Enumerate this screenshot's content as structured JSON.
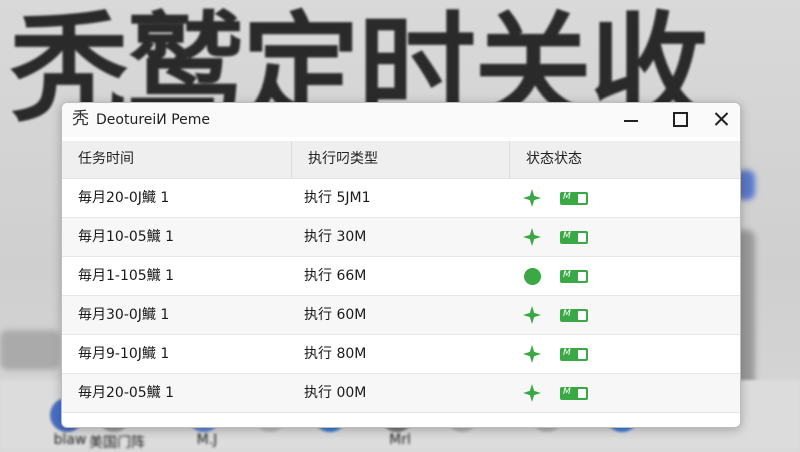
{
  "background": {
    "title_text": "秃鹫定时关收",
    "taskbar": [
      {
        "label": "blaw",
        "icon": "app-icon",
        "color": "#4a6fc4"
      },
      {
        "label": "美国门阵",
        "icon": "app-icon",
        "color": "#9a9a9a"
      },
      {
        "label": "M.J",
        "icon": "app-icon",
        "color": "#5d86d9"
      },
      {
        "label": "",
        "icon": "app-icon",
        "color": "#bdbdbd"
      },
      {
        "label": "",
        "icon": "app-icon",
        "color": "#3a7fd8"
      },
      {
        "label": "Mrl",
        "icon": "app-icon",
        "color": "#7a7a7a"
      },
      {
        "label": "",
        "icon": "app-icon",
        "color": "#b5b5b5"
      },
      {
        "label": "",
        "icon": "app-icon",
        "color": "#b5b5b5"
      },
      {
        "label": "",
        "icon": "app-icon",
        "color": "#3f7fd6"
      }
    ]
  },
  "window": {
    "icon_glyph": "秃",
    "title": "DeotureiИ Peme",
    "controls": {
      "minimize": "minimize",
      "maximize": "maximize",
      "close": "close"
    }
  },
  "table": {
    "columns": [
      "任务时间",
      "执行叼类型",
      "状态状态"
    ],
    "rows": [
      {
        "time": "毎月20-0J鱵 1",
        "type": "执行 5JM1",
        "status_icon": "star",
        "toggle": "M"
      },
      {
        "time": "毎月10-05鱵 1",
        "type": "执行 30M",
        "status_icon": "star",
        "toggle": "M"
      },
      {
        "time": "毎月1-105鱵 1",
        "type": "执行 66M",
        "status_icon": "dot",
        "toggle": "M"
      },
      {
        "time": "毎月30-0J鱵 1",
        "type": "执行 60M",
        "status_icon": "star",
        "toggle": "M"
      },
      {
        "time": "毎月9-10J鱵 1",
        "type": "执行 80M",
        "status_icon": "star",
        "toggle": "M"
      },
      {
        "time": "毎月20-05鱵 1",
        "type": "执行 00M",
        "status_icon": "star",
        "toggle": "M"
      }
    ]
  },
  "colors": {
    "accent": "#3aa845",
    "header_bg": "#efefef",
    "row_alt": "#f7f7f7"
  }
}
